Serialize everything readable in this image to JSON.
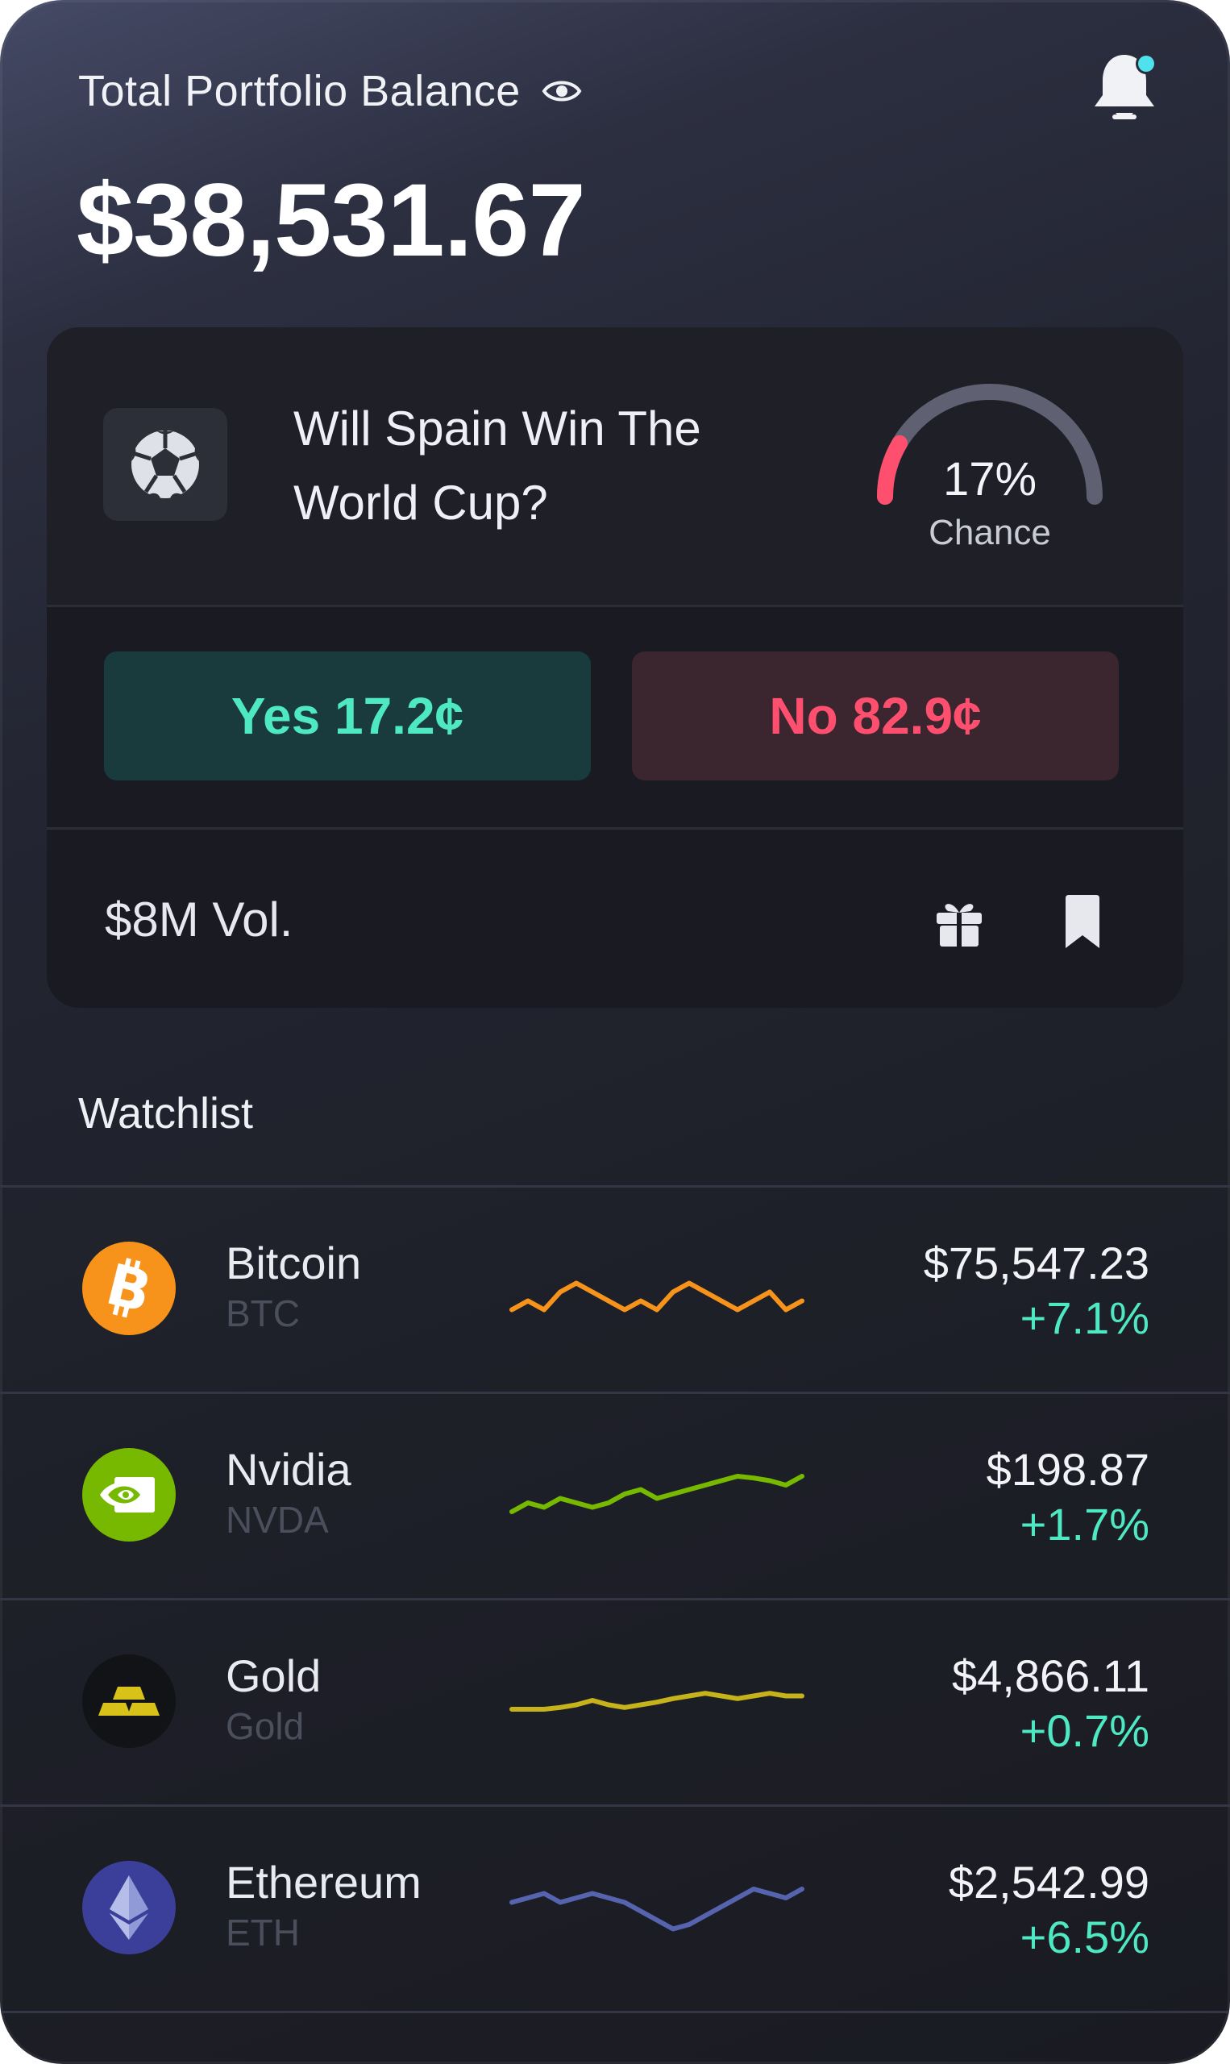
{
  "header": {
    "title": "Total Portfolio Balance",
    "visibility_icon": "eye-icon",
    "balance": "$38,531.67",
    "notification_icon": "bell-icon",
    "notification_dot_color": "#4fe1ec"
  },
  "market": {
    "icon": "soccer-ball-icon",
    "question_line1": "Will Spain Win The",
    "question_line2": "World Cup?",
    "chance_value": 17,
    "chance_text": "17%",
    "chance_label": "Chance",
    "yes_label": "Yes 17.2¢",
    "no_label": "No 82.9¢",
    "volume": "$8M Vol.",
    "gift_icon": "gift-icon",
    "bookmark_icon": "bookmark-icon",
    "colors": {
      "yes": "#4ee8c3",
      "no": "#ff4f6f",
      "gauge_active": "#ff4f6f",
      "gauge_track": "#5f6172"
    }
  },
  "watchlist": {
    "title": "Watchlist",
    "items": [
      {
        "name": "Bitcoin",
        "ticker": "BTC",
        "price": "$75,547.23",
        "change": "+7.1%",
        "icon": "bitcoin-icon",
        "color": "#f7931a",
        "spark": [
          25,
          35,
          25,
          45,
          55,
          45,
          35,
          25,
          35,
          25,
          45,
          55,
          45,
          35,
          25,
          35,
          45,
          25,
          35
        ]
      },
      {
        "name": "Nvidia",
        "ticker": "NVDA",
        "price": "$198.87",
        "change": "+1.7%",
        "icon": "nvidia-icon",
        "color": "#76b900",
        "spark": [
          30,
          40,
          35,
          45,
          40,
          35,
          40,
          50,
          55,
          45,
          50,
          55,
          60,
          65,
          70,
          68,
          65,
          60,
          70
        ]
      },
      {
        "name": "Gold",
        "ticker": "Gold",
        "price": "$4,866.11",
        "change": "+0.7%",
        "icon": "gold-bars-icon",
        "color": "#c6b21a",
        "spark": [
          40,
          40,
          40,
          42,
          45,
          50,
          45,
          42,
          45,
          48,
          52,
          55,
          58,
          55,
          52,
          55,
          58,
          55,
          55
        ]
      },
      {
        "name": "Ethereum",
        "ticker": "ETH",
        "price": "$2,542.99",
        "change": "+6.5%",
        "icon": "ethereum-icon",
        "color": "#5664b0",
        "spark": [
          55,
          60,
          65,
          55,
          60,
          65,
          60,
          55,
          45,
          35,
          25,
          30,
          40,
          50,
          60,
          70,
          65,
          60,
          70
        ]
      }
    ]
  }
}
